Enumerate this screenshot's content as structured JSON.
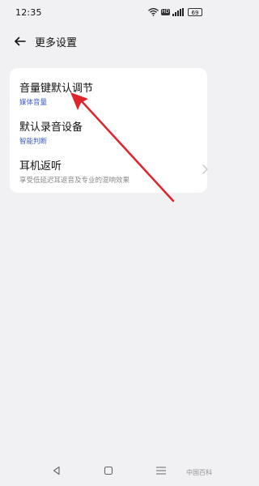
{
  "status_bar": {
    "time": "12:35",
    "icons": [
      "wifi-icon",
      "hd-icon",
      "signal-icon",
      "battery-icon"
    ],
    "hd_label": "HD",
    "battery_level": "69"
  },
  "header": {
    "back_icon": "back-arrow-icon",
    "title": "更多设置"
  },
  "settings": {
    "items": [
      {
        "title": "音量键默认调节",
        "subtitle": "媒体音量",
        "subtitle_color": "#3f5cc4"
      },
      {
        "title": "默认录音设备",
        "subtitle": "智能判断",
        "subtitle_color": "#3f5cc4"
      },
      {
        "title": "耳机返听",
        "subtitle": "享受低延迟耳返音及专业的混响效果",
        "subtitle_color": "#8a8a8a",
        "icon": "chevron-right-icon"
      }
    ]
  },
  "annotation": {
    "icon": "red-arrow-annotation",
    "color": "#e0242b"
  },
  "nav_bar": {
    "icons": [
      "nav-back-icon",
      "nav-home-icon",
      "nav-menu-icon"
    ]
  },
  "watermark": "中国百科"
}
